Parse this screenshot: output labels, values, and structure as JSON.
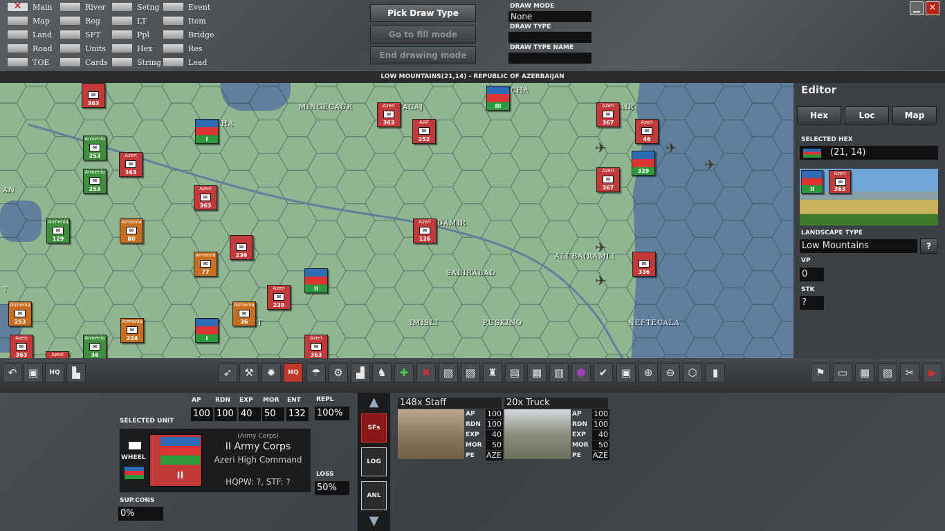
{
  "toggles": [
    {
      "label": "Main",
      "on": true
    },
    {
      "label": "Map",
      "on": false
    },
    {
      "label": "Land",
      "on": false
    },
    {
      "label": "Road",
      "on": false
    },
    {
      "label": "TOE",
      "on": false
    },
    {
      "label": "River",
      "on": false
    },
    {
      "label": "Reg",
      "on": false
    },
    {
      "label": "SFT",
      "on": false
    },
    {
      "label": "Units",
      "on": false
    },
    {
      "label": "Cards",
      "on": false
    },
    {
      "label": "Setng",
      "on": false
    },
    {
      "label": "LT",
      "on": false
    },
    {
      "label": "Ppl",
      "on": false
    },
    {
      "label": "Hex",
      "on": false
    },
    {
      "label": "String",
      "on": false
    },
    {
      "label": "Event",
      "on": false
    },
    {
      "label": "Item",
      "on": false
    },
    {
      "label": "Bridge",
      "on": false
    },
    {
      "label": "Res",
      "on": false
    },
    {
      "label": "Lead",
      "on": false
    }
  ],
  "draw_buttons": {
    "pick": "Pick Draw Type",
    "fill": "Go to fill mode",
    "end": "End drawing mode"
  },
  "draw_info": {
    "mode_label": "DRAW MODE",
    "mode_value": "None",
    "type_label": "DRAW TYPE",
    "type_value": "",
    "name_label": "DRAW TYPE NAME",
    "name_value": ""
  },
  "window": {
    "minimize": "▁",
    "close": "✕"
  },
  "hex_title": "LOW MOUNTAINS(21,14) - REPUBLIC OF AZERBAIJAN",
  "towns": [
    "MINGECAUR",
    "ACAJ",
    "CHA",
    "HA",
    "AIR",
    "DAMIR",
    "SABIRABAD",
    "ALI BAIRAMLI",
    "IMISLI",
    "PUSKINO",
    "NEFTECALA",
    "AN",
    "T",
    "T"
  ],
  "units": [
    {
      "nat": "",
      "num": "363",
      "cls": "u-az"
    },
    {
      "nat": "Armenia",
      "num": "253",
      "cls": "u-arg"
    },
    {
      "nat": "Azeri",
      "num": "363",
      "cls": "u-az"
    },
    {
      "nat": "Armenia",
      "num": "253",
      "cls": "u-arg"
    },
    {
      "nat": "",
      "num": "I",
      "cls": "u-flag"
    },
    {
      "nat": "Azeri",
      "num": "363",
      "cls": "u-az"
    },
    {
      "nat": "AAF",
      "num": "252",
      "cls": "u-az"
    },
    {
      "nat": "",
      "num": "III",
      "cls": "u-flag"
    },
    {
      "nat": "Azeri",
      "num": "367",
      "cls": "u-az"
    },
    {
      "nat": "Azeri",
      "num": "46",
      "cls": "u-az"
    },
    {
      "nat": "",
      "num": "329",
      "cls": "u-flag"
    },
    {
      "nat": "Azeri",
      "num": "367",
      "cls": "u-az"
    },
    {
      "nat": "Azeri",
      "num": "363",
      "cls": "u-az"
    },
    {
      "nat": "Armenia",
      "num": "129",
      "cls": "u-arg"
    },
    {
      "nat": "Armenia",
      "num": "80",
      "cls": "u-ar"
    },
    {
      "nat": "",
      "num": "239",
      "cls": "u-az"
    },
    {
      "nat": "Azeri",
      "num": "126",
      "cls": "u-az"
    },
    {
      "nat": "Armenia",
      "num": "77",
      "cls": "u-ar"
    },
    {
      "nat": "",
      "num": "II",
      "cls": "u-flag"
    },
    {
      "nat": "Azeri",
      "num": "239",
      "cls": "u-az"
    },
    {
      "nat": "",
      "num": "336",
      "cls": "u-az"
    },
    {
      "nat": "Armenia",
      "num": "253",
      "cls": "u-ar"
    },
    {
      "nat": "Armenia",
      "num": "36",
      "cls": "u-ar"
    },
    {
      "nat": "Armenia",
      "num": "224",
      "cls": "u-ar"
    },
    {
      "nat": "",
      "num": "I",
      "cls": "u-flag"
    },
    {
      "nat": "Azeri",
      "num": "363",
      "cls": "u-az"
    },
    {
      "nat": "Armenia",
      "num": "36",
      "cls": "u-arg"
    },
    {
      "nat": "Azeri",
      "num": "363",
      "cls": "u-az"
    },
    {
      "nat": "Azeri",
      "num": "363",
      "cls": "u-az"
    }
  ],
  "editor": {
    "title": "Editor",
    "tabs": [
      "Hex",
      "Loc",
      "Map"
    ],
    "selected_hex_label": "SELECTED HEX",
    "selected_hex_value": "(21, 14)",
    "stack_units": [
      {
        "nat": "",
        "num": "II"
      },
      {
        "nat": "Azeri",
        "num": "363"
      }
    ],
    "landscape_label": "LANDSCAPE TYPE",
    "landscape_value": "Low Mountains",
    "help": "?",
    "vp_label": "VP",
    "vp_value": "0",
    "stk_label": "STK",
    "stk_value": "?"
  },
  "toolbar_icons": [
    "undo-icon",
    "computer-icon",
    "hq-icon",
    "factory-icon",
    "rocket-icon",
    "artillery-icon",
    "bomb-icon",
    "hq-flag-icon",
    "parachute-icon",
    "mortar-icon",
    "fort-icon",
    "boots-icon",
    "add-unit-icon",
    "remove-unit-icon",
    "pattern-icon",
    "pattern2-icon",
    "units-icon",
    "strip-icon",
    "city-icon",
    "stack-icon",
    "purple-hex-icon",
    "check-icon",
    "print-icon",
    "zoom-in-icon",
    "zoom-out-icon",
    "hex-view-icon",
    "counter-icon",
    "flag-icon",
    "book-icon",
    "grid-icon",
    "pattern3-icon",
    "tools-icon",
    "next-turn-icon"
  ],
  "toolbar_labels": {
    "hq": "HQ",
    "hq_flag": "HQ"
  },
  "selected_unit": {
    "label": "SELECTED UNIT",
    "stats_labels": [
      "AP",
      "RDN",
      "EXP",
      "MOR",
      "ENT"
    ],
    "stats_values": [
      "100",
      "100",
      "40",
      "50",
      "132"
    ],
    "repl_label": "REPL",
    "repl_value": "100%",
    "loss_label": "LOSS",
    "loss_value": "50%",
    "wheel_label": "WHEEL",
    "counter_num": "II",
    "type_text": "(Army Corps)",
    "name": "II Army Corps",
    "hq": "Azeri High Command",
    "hqpw": "HQPW: ?, STF: ?",
    "supcons_label": "SUP.CONS",
    "supcons_value": "0%"
  },
  "side_buttons": [
    "SFs",
    "LOG",
    "ANL"
  ],
  "cards": [
    {
      "title": "148x Staff",
      "stats": [
        [
          "AP",
          "100"
        ],
        [
          "RDN",
          "100"
        ],
        [
          "EXP",
          "40"
        ],
        [
          "MOR",
          "50"
        ],
        [
          "PE",
          "AZE"
        ]
      ]
    },
    {
      "title": "20x Truck",
      "stats": [
        [
          "AP",
          "100"
        ],
        [
          "RDN",
          "100"
        ],
        [
          "EXP",
          "40"
        ],
        [
          "MOR",
          "50"
        ],
        [
          "PE",
          "AZE"
        ]
      ]
    }
  ]
}
